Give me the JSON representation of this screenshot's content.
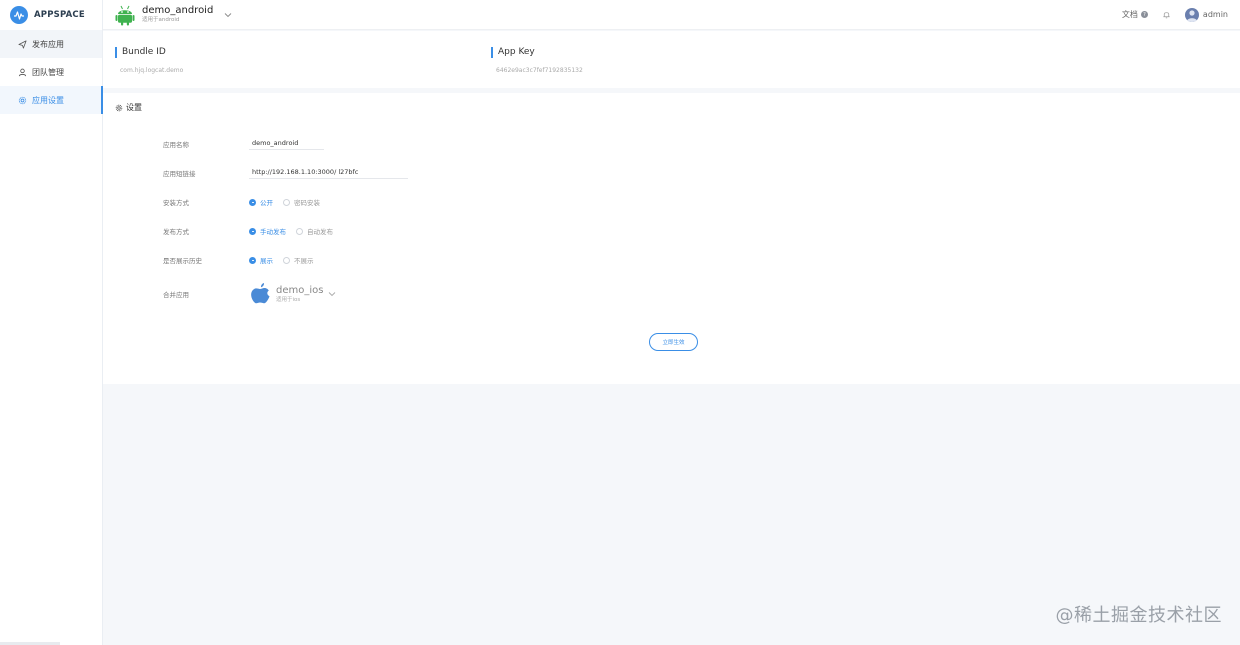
{
  "brand": {
    "name": "APPSPACE"
  },
  "sidebar": {
    "items": [
      {
        "label": "发布应用",
        "icon": "send-icon"
      },
      {
        "label": "团队管理",
        "icon": "team-icon"
      },
      {
        "label": "应用设置",
        "icon": "gear-icon",
        "active": true
      }
    ]
  },
  "header": {
    "app_name": "demo_android",
    "app_platform": "适用于android",
    "docs_label": "文档",
    "user_name": "admin"
  },
  "info": {
    "bundle_id_label": "Bundle ID",
    "bundle_id_value": "com.hjq.logcat.demo",
    "app_key_label": "App Key",
    "app_key_value": "6462e9ac3c7fef7192835132"
  },
  "settings": {
    "title": "设置",
    "fields": {
      "name_label": "应用名称",
      "name_value": "demo_android",
      "link_label": "应用短链接",
      "link_value": "http://192.168.1.10:3000/ l27bfc",
      "install_label": "安装方式",
      "install_options": [
        "公开",
        "密码安装"
      ],
      "publish_label": "发布方式",
      "publish_options": [
        "手动发布",
        "自动发布"
      ],
      "history_label": "是否展示历史",
      "history_options": [
        "展示",
        "不展示"
      ],
      "merge_label": "合并应用",
      "merge_app_name": "demo_ios",
      "merge_app_platform": "适用于ios"
    },
    "save_label": "立即生效"
  },
  "watermark": "@稀土掘金技术社区",
  "colors": {
    "accent": "#3a8ee6",
    "android": "#3fb24f",
    "apple": "#4a8ad6"
  }
}
